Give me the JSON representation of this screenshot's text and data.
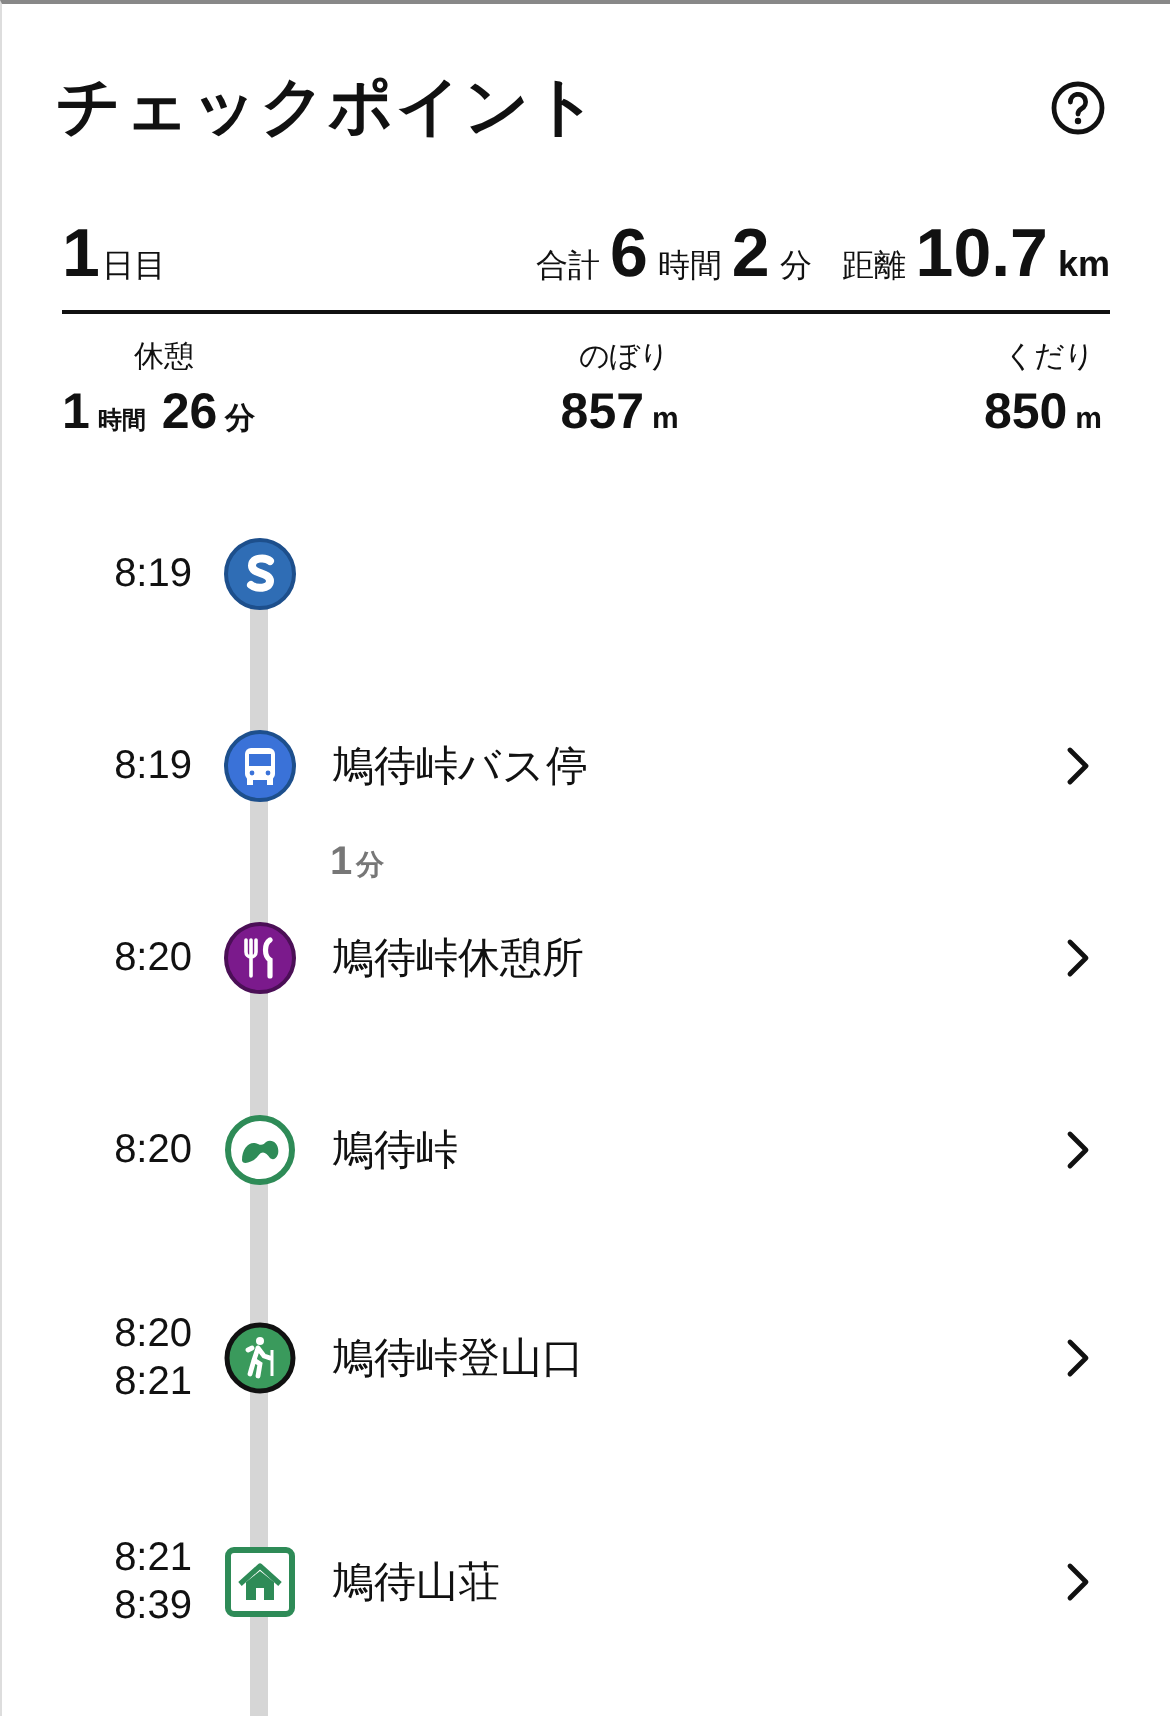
{
  "header": {
    "title": "チェックポイント"
  },
  "summary": {
    "day_number": "1",
    "day_unit": "日目",
    "total_label": "合計",
    "total_hours": "6",
    "hours_unit": "時間",
    "total_minutes": "2",
    "minutes_unit": "分",
    "distance_label": "距離",
    "distance": "10.7",
    "distance_unit": "km"
  },
  "stats": [
    {
      "label": "休憩",
      "parts": [
        {
          "value": "1",
          "unit": "時間"
        },
        {
          "value": "26",
          "unit": "分"
        }
      ]
    },
    {
      "label": "のぼり",
      "parts": [
        {
          "value": "857",
          "unit": "m"
        }
      ]
    },
    {
      "label": "くだり",
      "parts": [
        {
          "value": "850",
          "unit": "m"
        }
      ]
    }
  ],
  "checkpoints": [
    {
      "kind": "start",
      "color": "#2f6db5",
      "times": [
        "8:19"
      ]
    },
    {
      "kind": "bus",
      "color": "#3a72d8",
      "times": [
        "8:19"
      ],
      "name": "鳩待峠バス停",
      "duration": {
        "value": "1",
        "unit": "分"
      }
    },
    {
      "kind": "restaurant",
      "color": "#7b1a8c",
      "times": [
        "8:20"
      ],
      "name": "鳩待峠休憩所"
    },
    {
      "kind": "pass",
      "color": "#2e8b57",
      "times": [
        "8:20"
      ],
      "name": "鳩待峠"
    },
    {
      "kind": "trailhead",
      "color": "#3a9a5c",
      "times": [
        "8:20",
        "8:21"
      ],
      "name": "鳩待峠登山口"
    },
    {
      "kind": "hut",
      "color": "#2e8b57",
      "times": [
        "8:21",
        "8:39"
      ],
      "name": "鳩待山荘"
    }
  ]
}
